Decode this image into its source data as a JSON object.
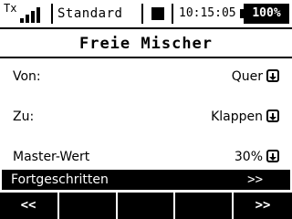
{
  "status_bar": {
    "tx_label": "Tx",
    "signal_bars": 4,
    "model_name": "Standard",
    "clock": "10:15:05",
    "battery": "100%"
  },
  "page": {
    "title": "Freie Mischer"
  },
  "rows": [
    {
      "label": "Von:",
      "value": "Quer"
    },
    {
      "label": "Zu:",
      "value": "Klappen"
    },
    {
      "label": "Master-Wert",
      "value": "30%"
    }
  ],
  "advanced": {
    "label": "Fortgeschritten",
    "arrow": ">>"
  },
  "softkeys": {
    "prev": "<<",
    "next": ">>"
  }
}
